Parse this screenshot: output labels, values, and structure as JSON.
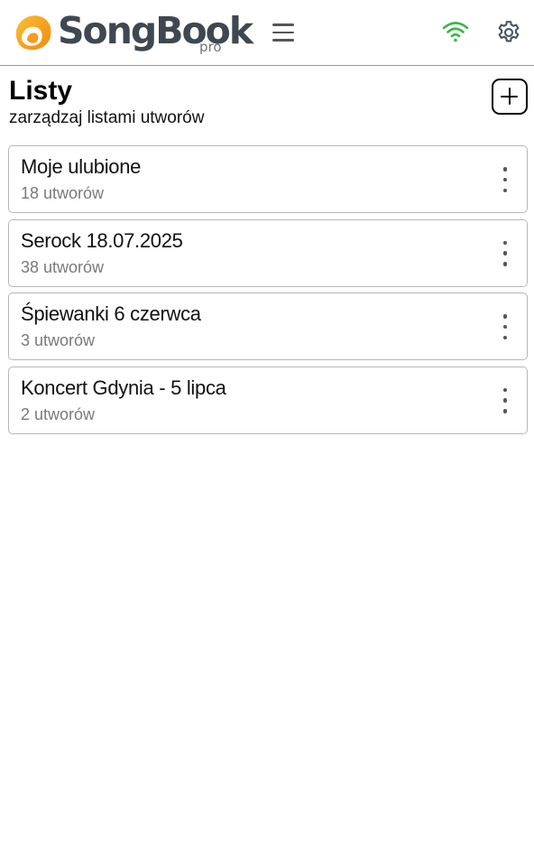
{
  "app": {
    "logo_text": "SongBook",
    "logo_sub": "pro"
  },
  "colors": {
    "logo_orange": "#f39c1f",
    "logo_orange_light": "#fbbf33",
    "wifi_green": "#3cb54a",
    "header_border": "#9a9a9a"
  },
  "header": {
    "menu_icon": "hamburger-menu-icon",
    "status_icon": "wifi-icon",
    "settings_icon": "gear-icon"
  },
  "page": {
    "title": "Listy",
    "subtitle": "zarządzaj listami utworów",
    "add_icon": "plus-square-icon"
  },
  "lists": [
    {
      "name": "Moje ulubione",
      "count": "18 utworów"
    },
    {
      "name": "Serock 18.07.2025",
      "count": "38 utworów"
    },
    {
      "name": "Śpiewanki 6 czerwca",
      "count": "3 utworów"
    },
    {
      "name": "Koncert Gdynia - 5 lipca",
      "count": "2 utworów"
    }
  ]
}
